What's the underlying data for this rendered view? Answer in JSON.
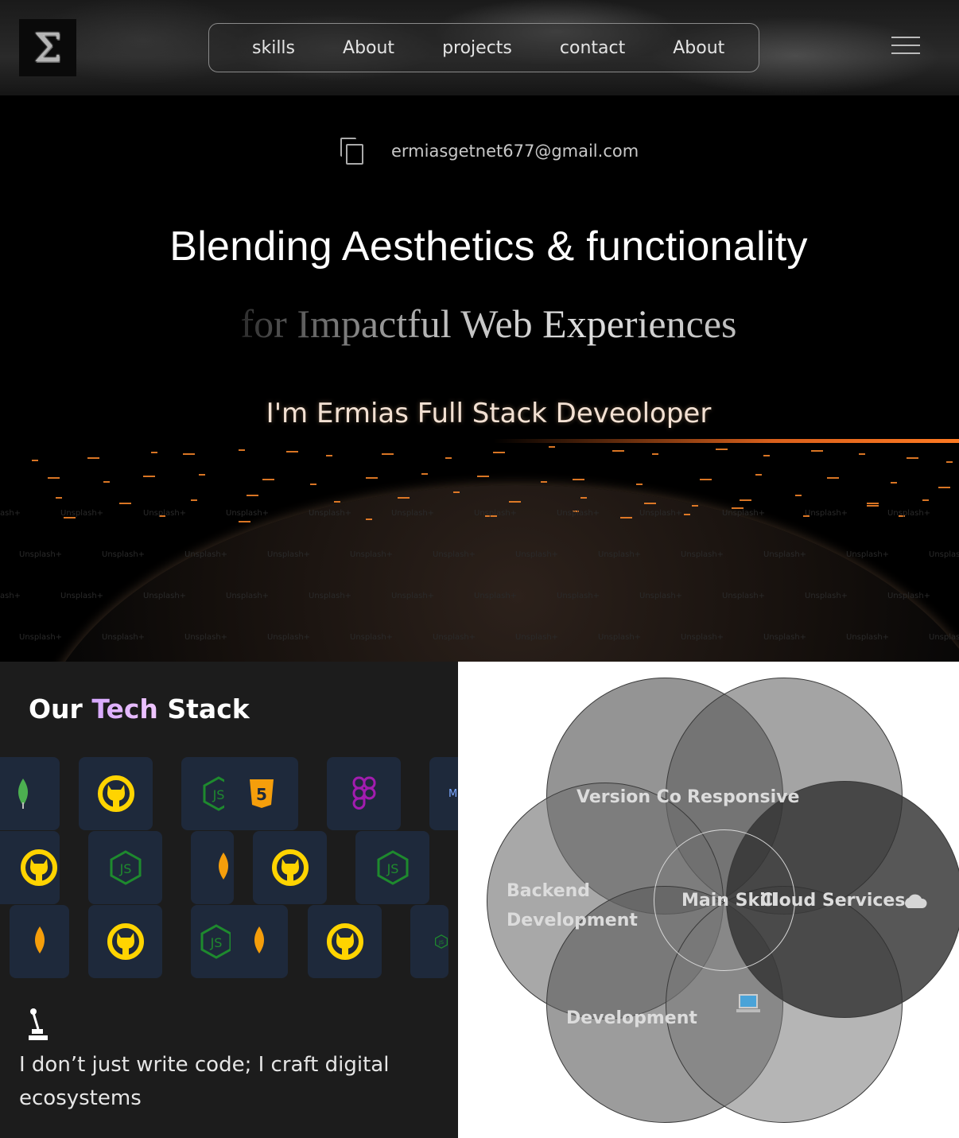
{
  "header": {
    "logo_glyph": "Σ",
    "nav": [
      "skills",
      "About",
      "projects",
      "contact",
      "About"
    ]
  },
  "hero": {
    "email": "ermiasgetnet677@gmail.com",
    "headline": "Blending Aesthetics & functionality",
    "subheadline": "for Impactful Web Experiences",
    "intro": "I'm Ermias Full Stack Deveoloper",
    "watermark": "Unsplash+",
    "accent_color": "#d9601c"
  },
  "tech": {
    "title_pre": "Our ",
    "title_hl": "Tech",
    "title_post": " Stack",
    "tile_m_letter": "M",
    "quote": "I don’t just write code; I craft digital ecosystems",
    "icons": [
      "mongodb-leaf",
      "github",
      "nodejs",
      "html5",
      "figma",
      "github",
      "nodejs",
      "mongodb-leaf",
      "github",
      "nodejs",
      "mongodb-leaf",
      "github",
      "nodejs",
      "mongodb-leaf",
      "github",
      "nodejs"
    ]
  },
  "venn": {
    "center": "Main Skill",
    "labels": {
      "version": "Version Co",
      "responsive": "Responsive",
      "cloud": "Cloud Services",
      "backend_line1": "Backend",
      "backend_line2": "Development",
      "bottom": "Development"
    },
    "icons": [
      "cloud-icon",
      "laptop-icon"
    ]
  }
}
